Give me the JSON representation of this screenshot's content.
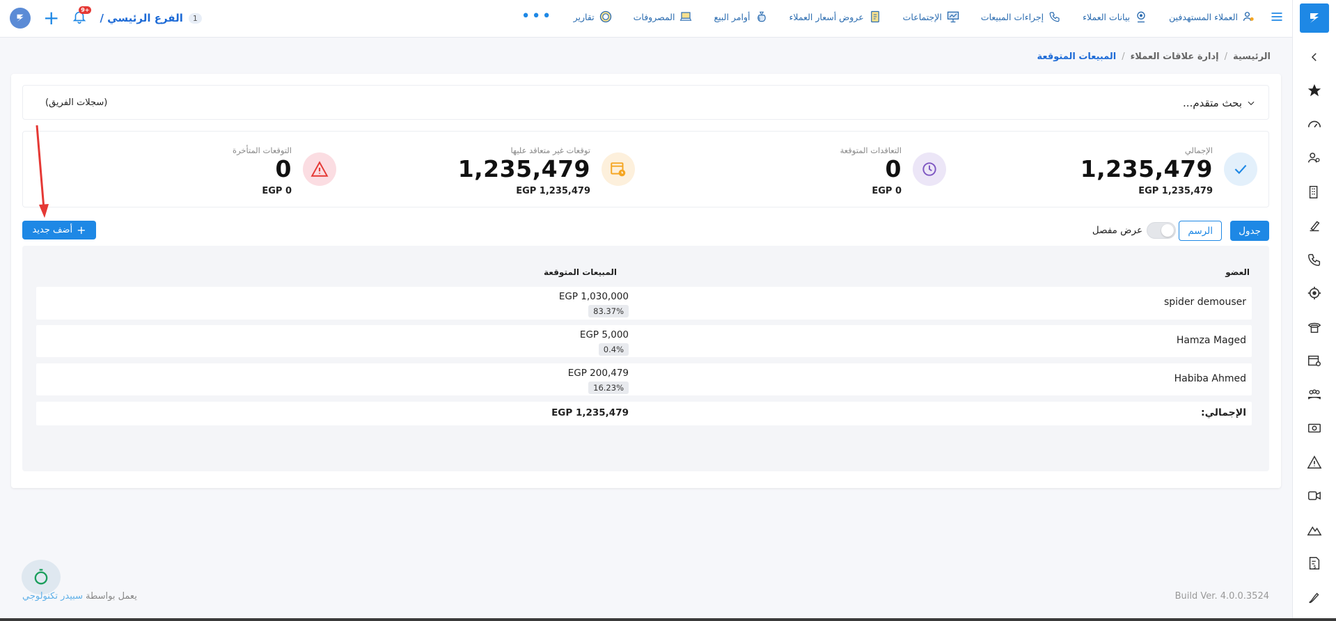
{
  "topbar": {
    "nav": [
      {
        "label": "العملاء المستهدفين",
        "icon": "users-target-icon"
      },
      {
        "label": "بيانات العملاء",
        "icon": "customer-data-icon"
      },
      {
        "label": "إجراءات المبيعات",
        "icon": "phone-icon"
      },
      {
        "label": "الإجتماعات",
        "icon": "presentation-icon"
      },
      {
        "label": "عروض أسعار العملاء",
        "icon": "quote-icon"
      },
      {
        "label": "أوامر البيع",
        "icon": "money-bag-icon"
      },
      {
        "label": "المصروفات",
        "icon": "laptop-icon"
      },
      {
        "label": "تقارير",
        "icon": "report-icon"
      }
    ],
    "more": "•••",
    "branch_label": "الفرع الرئيسي /",
    "branch_number": "1",
    "notifications_badge": "+9"
  },
  "breadcrumb": {
    "home": "الرئيسية",
    "crm": "إدارة علاقات العملاء",
    "current": "المبيعات المتوقعة",
    "sep": "/"
  },
  "search": {
    "advanced_label": "بحث متقدم...",
    "team_label": "(سجلات الفريق)"
  },
  "stats": [
    {
      "title": "الإجمالي",
      "value": "1,235,479",
      "sub": "EGP 1,235,479",
      "color": "#1e88e5",
      "bg": "#e3f0fb",
      "icon": "check-icon"
    },
    {
      "title": "التعاقدات المتوقعة",
      "value": "0",
      "sub": "EGP 0",
      "color": "#7e57c2",
      "bg": "#ece6f7",
      "icon": "clock-icon"
    },
    {
      "title": "توقعات غير متعاقد عليها",
      "value": "1,235,479",
      "sub": "EGP 1,235,479",
      "color": "#f5a623",
      "bg": "#fdf0dc",
      "icon": "calendar-clock-icon"
    },
    {
      "title": "التوقعات المتأخرة",
      "value": "0",
      "sub": "EGP 0",
      "color": "#e53935",
      "bg": "#fbdde2",
      "icon": "warning-icon"
    }
  ],
  "controls": {
    "table_btn": "جدول",
    "chart_btn": "الرسم",
    "detailed_label": "عرض مفصل",
    "detailed_on": false,
    "add_new": "أضف جديد"
  },
  "table": {
    "headers": {
      "member": "العضو",
      "expected_sales": "المبيعات المتوقعة"
    },
    "rows": [
      {
        "member": "spider demouser",
        "amount": "EGP 1,030,000",
        "pct": "83.37%"
      },
      {
        "member": "Hamza Maged",
        "amount": "EGP 5,000",
        "pct": "0.4%"
      },
      {
        "member": "Habiba Ahmed",
        "amount": "EGP 200,479",
        "pct": "16.23%"
      }
    ],
    "total_label": "الإجمالي:",
    "total_amount": "EGP 1,235,479"
  },
  "footer": {
    "powered_prefix": "يعمل بواسطة",
    "powered_brand": "سبيدر تكنولوجي",
    "build": "Build Ver. 4.0.0.3524"
  },
  "colors": {
    "accent": "#1e88e5",
    "annotation": "#e53935"
  }
}
